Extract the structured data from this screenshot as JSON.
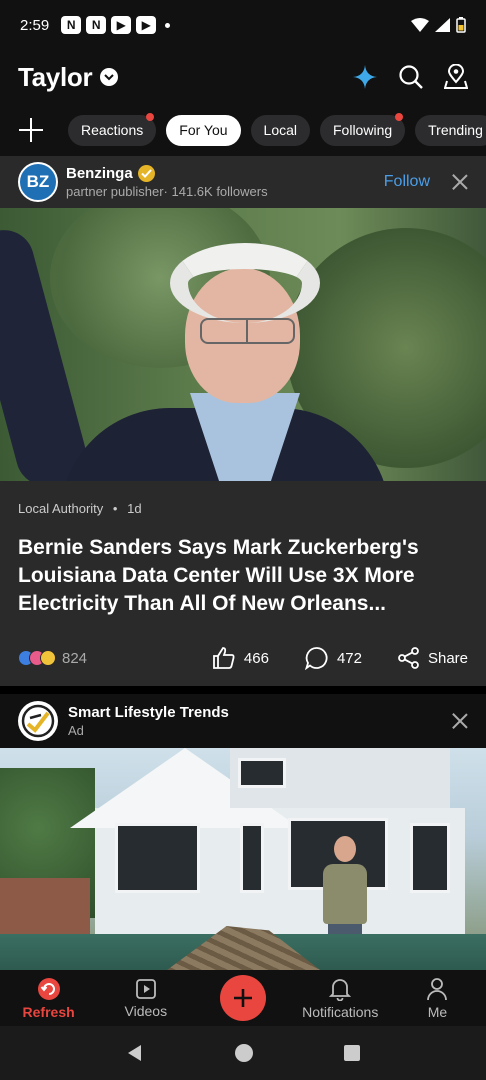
{
  "status_bar": {
    "time": "2:59"
  },
  "header": {
    "title": "Taylor"
  },
  "tabs": [
    {
      "label": "Reactions",
      "active": false,
      "dot": true
    },
    {
      "label": "For You",
      "active": true,
      "dot": false
    },
    {
      "label": "Local",
      "active": false,
      "dot": false
    },
    {
      "label": "Following",
      "active": false,
      "dot": true
    },
    {
      "label": "Trending",
      "active": false,
      "dot": false
    }
  ],
  "post": {
    "publisher": "Benzinga",
    "publisher_logo": "BZ",
    "publisher_meta": "partner publisher· 141.6K followers",
    "follow_label": "Follow",
    "source": "Local Authority",
    "age": "1d",
    "headline": "Bernie Sanders Says Mark Zuckerberg's Louisiana Data Center Will Use 3X More Electricity Than All Of New Orleans...",
    "reaction_count": "824",
    "like_count": "466",
    "comment_count": "472",
    "share_label": "Share"
  },
  "ad": {
    "name": "Smart Lifestyle Trends",
    "label": "Ad"
  },
  "bottom_nav": [
    {
      "label": "Refresh",
      "icon": "refresh-icon",
      "active": true
    },
    {
      "label": "Videos",
      "icon": "video-icon",
      "active": false
    },
    {
      "label": "",
      "icon": "plus-icon",
      "active": false
    },
    {
      "label": "Notifications",
      "icon": "bell-icon",
      "active": false
    },
    {
      "label": "Me",
      "icon": "person-icon",
      "active": false
    }
  ],
  "colors": {
    "accent": "#e8463f",
    "follow": "#4a9ee8",
    "verified": "#e5b427"
  }
}
